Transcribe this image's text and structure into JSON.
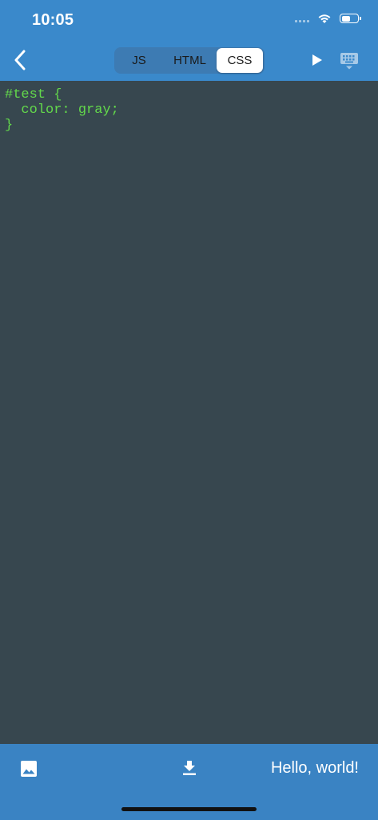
{
  "status_bar": {
    "time": "10:05",
    "battery_level": 0.6
  },
  "toolbar": {
    "tabs": [
      {
        "label": "JS",
        "selected": false
      },
      {
        "label": "HTML",
        "selected": false
      },
      {
        "label": "CSS",
        "selected": true
      }
    ],
    "icons": {
      "back": "chevron-left-icon",
      "run": "play-icon",
      "keyboard": "keyboard-hide-icon"
    }
  },
  "editor": {
    "language": "CSS",
    "lines": [
      "#test {",
      "  color: gray;",
      "}"
    ],
    "text_color": "#63d94b",
    "background": "#37474f"
  },
  "bottom_bar": {
    "output_text": "Hello, world!",
    "icons": {
      "image": "image-icon",
      "download": "download-icon"
    }
  },
  "colors": {
    "accent": "#3a89cb",
    "editor_bg": "#37474f",
    "code_green": "#63d94b"
  }
}
